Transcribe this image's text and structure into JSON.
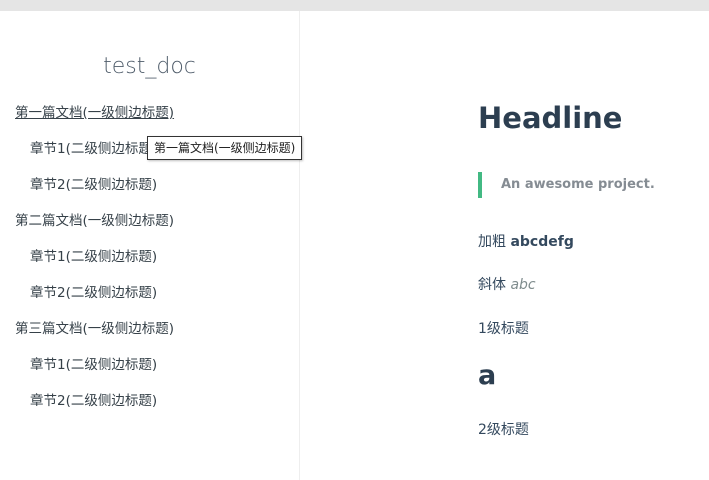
{
  "sidebar": {
    "app_name": "test_doc",
    "items": [
      {
        "label": "第一篇文档(一级侧边标题)"
      },
      {
        "label": "章节1(二级侧边标题)"
      },
      {
        "label": "章节2(二级侧边标题)"
      },
      {
        "label": "第二篇文档(一级侧边标题)"
      },
      {
        "label": "章节1(二级侧边标题)"
      },
      {
        "label": "章节2(二级侧边标题)"
      },
      {
        "label": "第三篇文档(一级侧边标题)"
      },
      {
        "label": "章节1(二级侧边标题)"
      },
      {
        "label": "章节2(二级侧边标题)"
      }
    ],
    "tooltip": "第一篇文档(一级侧边标题)"
  },
  "content": {
    "headline": "Headline",
    "quote": "An awesome project.",
    "bold_prefix": "加粗 ",
    "bold_text": "abcdefg",
    "italic_prefix": "斜体 ",
    "italic_text": "abc",
    "level1_text": "1级标题",
    "heading_a": "a",
    "level2_text": "2级标题"
  },
  "colors": {
    "accent": "#42b983",
    "heading": "#2c3e50",
    "text": "#34495e",
    "topbar": "#e5e5e5"
  }
}
